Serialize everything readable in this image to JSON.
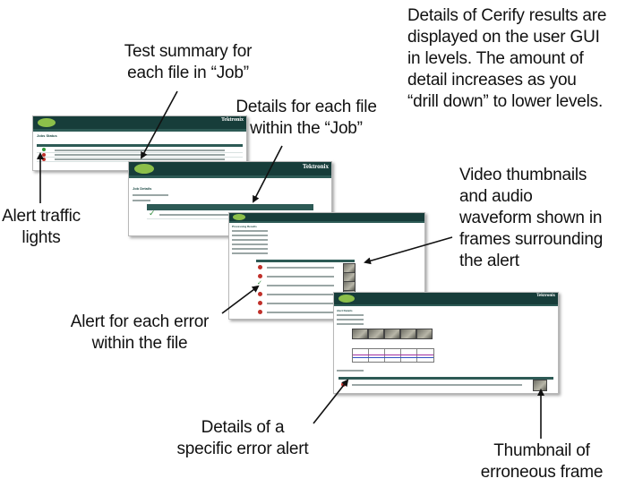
{
  "callouts": {
    "intro": [
      "Details of Cerify results are",
      "displayed on the user GUI",
      "in levels. The amount of",
      "detail increases as you",
      "“drill down” to lower levels."
    ],
    "test_summary": [
      "Test summary for",
      "each file in “Job”"
    ],
    "details_each_file": [
      "Details for each file",
      "within the “Job”"
    ],
    "video_thumbnails": [
      "Video thumbnails",
      "and audio",
      "waveform shown in",
      "frames surrounding",
      "the alert"
    ],
    "alert_traffic": [
      "Alert traffic",
      "lights"
    ],
    "alert_each_error": [
      "Alert for each error",
      "within the file"
    ],
    "details_specific": [
      "Details of a",
      "specific error alert"
    ],
    "thumbnail_erroneous": [
      "Thumbnail of",
      "erroneous frame"
    ]
  },
  "screenshots": {
    "brand": "Tektronix",
    "level1_title": "Jobs Status",
    "level2_title": "Job Details",
    "level3_title": "Processing Results",
    "level4_title": "Alert Details"
  },
  "colors": {
    "header": "#173d3a",
    "nav": "#2d5a55",
    "logo": "#8cbf4a",
    "alert_red": "#c0302a",
    "ok_green": "#2f9a3a"
  }
}
